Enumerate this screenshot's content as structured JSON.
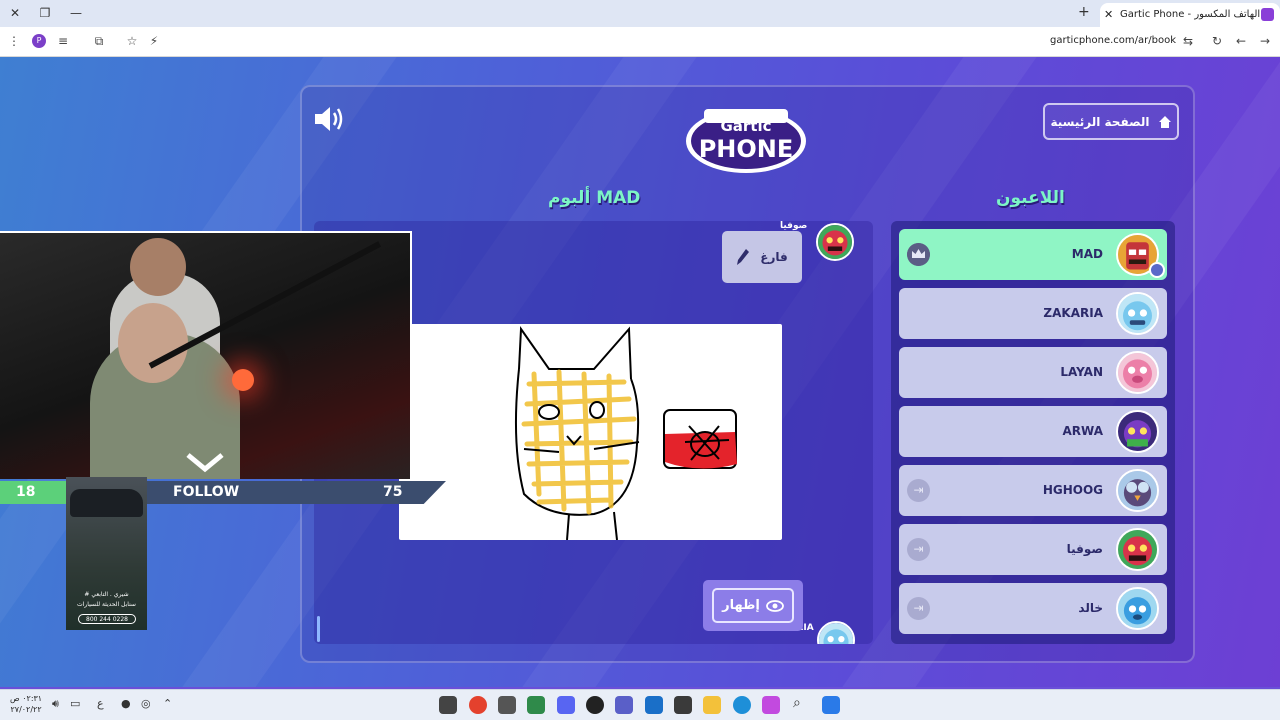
{
  "browser": {
    "tab_title": "Gartic Phone - الهاتف المكسور",
    "url": "garticphone.com/ar/book",
    "profile_initial": "P"
  },
  "header": {
    "home_label": "الصفحة الرئيسية",
    "logo_top": "Gartic",
    "logo_bottom": "PHONE"
  },
  "players_title": "اللاعبون",
  "album_title": "ألبوم MAD",
  "players": [
    {
      "name": "MAD",
      "status": "host",
      "active": true
    },
    {
      "name": "ZAKARIA",
      "status": "",
      "active": false
    },
    {
      "name": "LAYAN",
      "status": "",
      "active": false
    },
    {
      "name": "ARWA",
      "status": "",
      "active": false
    },
    {
      "name": "HGHOOG",
      "status": "kickable",
      "active": false
    },
    {
      "name": "صوفيا",
      "status": "kickable",
      "active": false
    },
    {
      "name": "خالد",
      "status": "kickable",
      "active": false
    }
  ],
  "album": {
    "top_author": "صوفيا",
    "empty_label": "فارغ",
    "bottom_author": "ZAKARIA",
    "show_label": "إظهار"
  },
  "stream_overlay": {
    "left_count": "18",
    "follow_label": "FOLLOW",
    "right_count": "75",
    "ad_line1": "# شيري . التابعي",
    "ad_line2": "سنابل الحديثة للسيارات",
    "ad_phone": "800 244 0228"
  },
  "taskbar": {
    "time": "٠٢:٣١ ص",
    "date": "٢٧/٠٢/٢٢",
    "lang": "ع"
  },
  "colors": {
    "accent_green": "#8ff5c5",
    "title_green": "#7cf5c6",
    "player_bg": "#c8cbeb"
  }
}
